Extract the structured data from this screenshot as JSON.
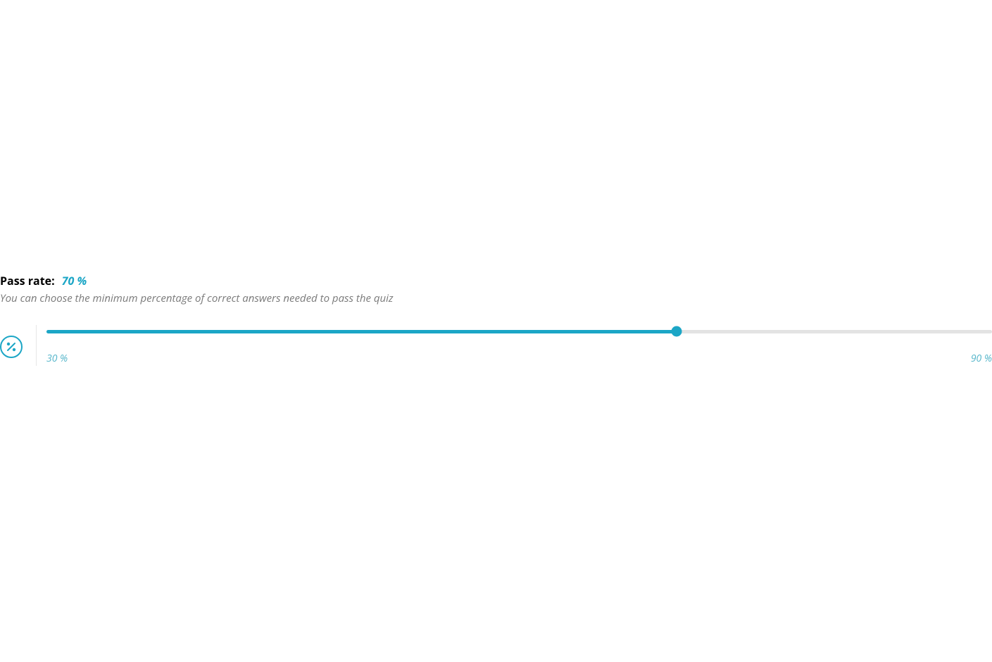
{
  "pass_rate": {
    "label": "Pass rate:",
    "value_display": "70 %",
    "description": "You can choose the minimum percentage of correct answers needed to pass the quiz",
    "slider": {
      "min": 30,
      "max": 90,
      "value": 70,
      "min_display": "30 %",
      "max_display": "90 %"
    },
    "colors": {
      "accent": "#1ca6c6",
      "track_bg": "#e3e3e3",
      "muted_text": "#7a7a7a"
    }
  }
}
